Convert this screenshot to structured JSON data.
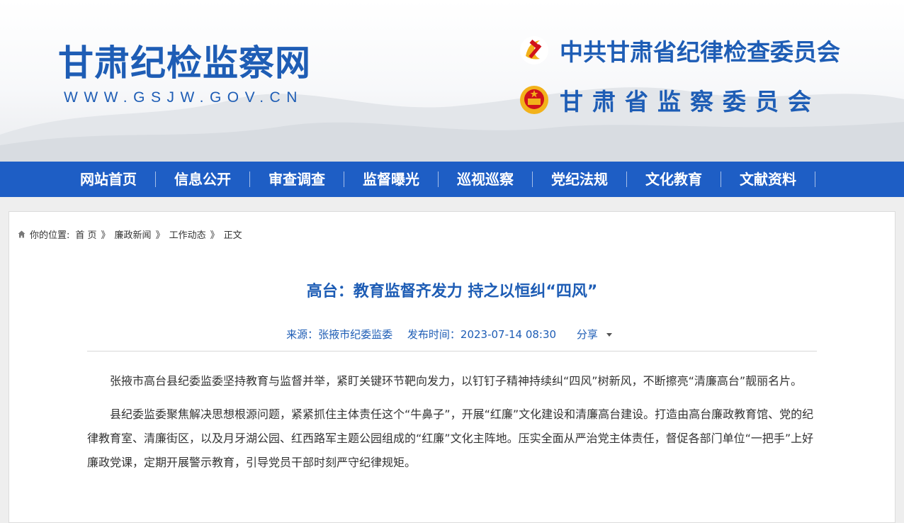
{
  "header": {
    "site_title": "甘肃纪检监察网",
    "site_url": "WWW.GSJW.GOV.CN",
    "org_line_1": "中共甘肃省纪律检查委员会",
    "org_line_2": "甘肃省监察委员会",
    "emblem_1": "party-emblem",
    "emblem_2": "national-emblem"
  },
  "nav": {
    "items": [
      "网站首页",
      "信息公开",
      "审查调查",
      "监督曝光",
      "巡视巡察",
      "党纪法规",
      "文化教育",
      "文献资料"
    ]
  },
  "breadcrumb": {
    "prefix": "你的位置:",
    "items": [
      "首 页",
      "廉政新闻",
      "工作动态"
    ],
    "separator": "》",
    "current": "正文"
  },
  "article": {
    "title": "高台：教育监督齐发力 持之以恒纠“四风”",
    "source": "来源：张掖市纪委监委",
    "published": "发布时间：2023-07-14 08:30",
    "share_label": "分享",
    "paragraphs": [
      "张掖市高台县纪委监委坚持教育与监督并举，紧盯关键环节靶向发力，以钉钉子精神持续纠“四风”树新风，不断擦亮“清廉高台”靓丽名片。",
      "县纪委监委聚焦解决思想根源问题，紧紧抓住主体责任这个“牛鼻子”，开展“红廉”文化建设和清廉高台建设。打造由高台廉政教育馆、党的纪律教育室、清廉街区，以及月牙湖公园、红西路军主题公园组成的“红廉”文化主阵地。压实全面从严治党主体责任，督促各部门单位“一把手”上好廉政党课，定期开展警示教育，引导党员干部时刻严守纪律规矩。"
    ]
  },
  "colors": {
    "brand_blue": "#1e5db5",
    "nav_blue": "#1e5ec5",
    "emblem_gold": "#f2b21b",
    "emblem_red": "#d0121b"
  }
}
